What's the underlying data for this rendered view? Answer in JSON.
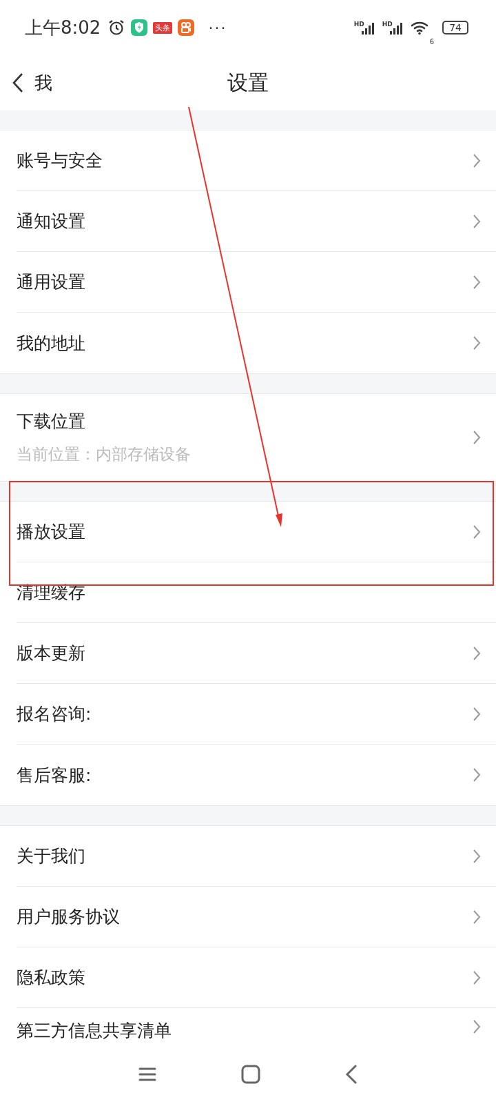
{
  "status_bar": {
    "time": "上午8:02",
    "app_badge": "头条",
    "more": "···",
    "signals": [
      {
        "label": "HD"
      },
      {
        "label": "HD"
      }
    ],
    "wifi_label": "6",
    "battery": "74"
  },
  "nav": {
    "back_label": "我",
    "title": "设置"
  },
  "groups": [
    {
      "items": [
        {
          "label": "账号与安全",
          "chevron": true
        },
        {
          "label": "通知设置",
          "chevron": true
        },
        {
          "label": "通用设置",
          "chevron": true
        },
        {
          "label": "我的地址",
          "chevron": true
        }
      ]
    },
    {
      "items": [
        {
          "label": "下载位置",
          "subtitle": "当前位置：内部存储设备",
          "chevron": true
        }
      ]
    },
    {
      "items": [
        {
          "label": "播放设置",
          "chevron": true
        },
        {
          "label": "清理缓存",
          "chevron": false
        },
        {
          "label": "版本更新",
          "chevron": true
        },
        {
          "label": "报名咨询:",
          "chevron": true
        },
        {
          "label": "售后客服:",
          "chevron": true
        }
      ]
    },
    {
      "items": [
        {
          "label": "关于我们",
          "chevron": true
        },
        {
          "label": "用户服务协议",
          "chevron": true
        },
        {
          "label": "隐私政策",
          "chevron": true
        },
        {
          "label": "第三方信息共享清单",
          "chevron": true
        }
      ]
    }
  ]
}
